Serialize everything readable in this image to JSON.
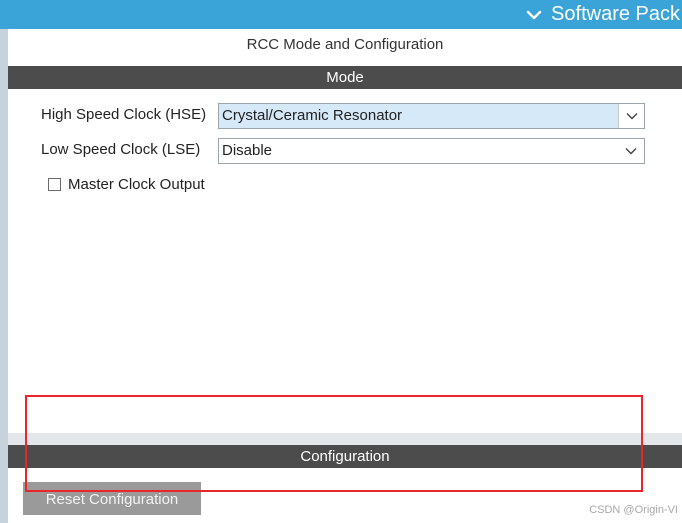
{
  "header": {
    "software_packs_label": "Software Pack",
    "chevron_icon": "chevron-down-icon"
  },
  "panel": {
    "title": "RCC Mode and Configuration"
  },
  "mode": {
    "section_title": "Mode",
    "hse": {
      "label": "High Speed Clock (HSE)",
      "value": "Crystal/Ceramic Resonator"
    },
    "lse": {
      "label": "Low Speed Clock (LSE)",
      "value": "Disable"
    },
    "master_clock_output": {
      "label": "Master Clock Output",
      "checked": false
    }
  },
  "configuration": {
    "section_title": "Configuration",
    "reset_button_label": "Reset Configuration"
  },
  "watermark": "CSDN @Origin-VI",
  "colors": {
    "topbar": "#3aa3d8",
    "section_bar": "#4c4c4c",
    "highlight_select": "#d6e9f8",
    "annotation_box": "#e8262b",
    "reset_button": "#9a9a9a"
  }
}
